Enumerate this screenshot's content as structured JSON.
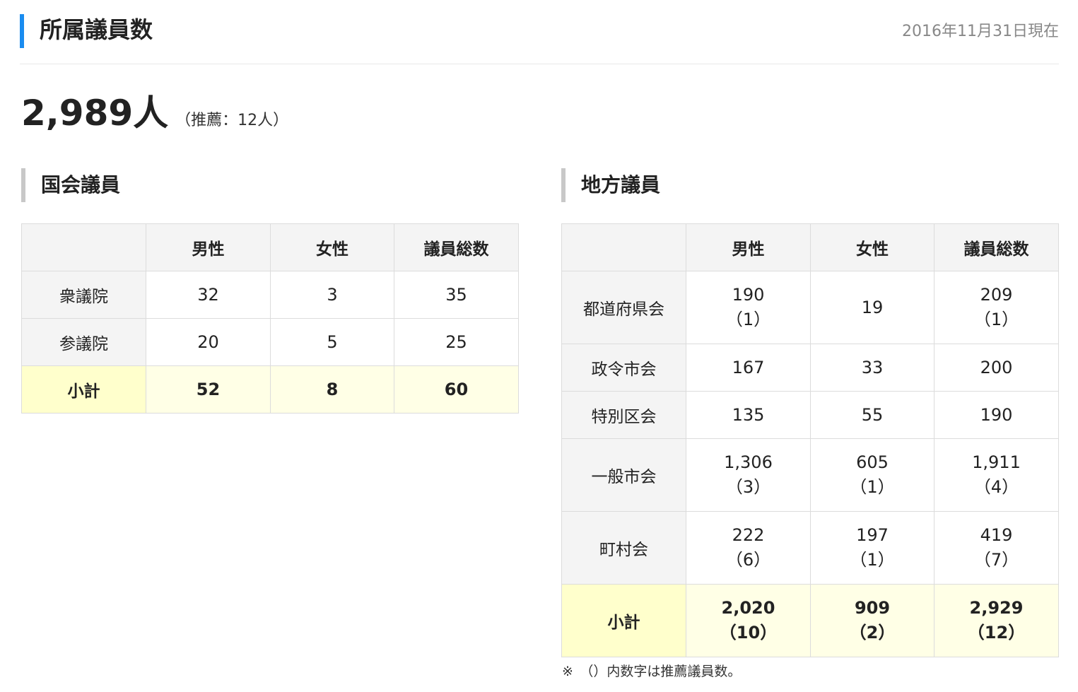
{
  "header": {
    "title": "所属議員数",
    "as_of": "2016年11月31日現在"
  },
  "summary": {
    "total": "2,989人",
    "note": "（推薦：12人）"
  },
  "national": {
    "heading": "国会議員",
    "columns": [
      "",
      "男性",
      "女性",
      "議員総数"
    ],
    "rows": [
      {
        "label": "衆議院",
        "male": "32",
        "female": "3",
        "total": "35"
      },
      {
        "label": "参議院",
        "male": "20",
        "female": "5",
        "total": "25"
      },
      {
        "label": "小計",
        "male": "52",
        "female": "8",
        "total": "60"
      }
    ]
  },
  "local": {
    "heading": "地方議員",
    "columns": [
      "",
      "男性",
      "女性",
      "議員総数"
    ],
    "rows": [
      {
        "label": "都道府県会",
        "male": "190",
        "male_rec": "（1）",
        "female": "19",
        "female_rec": "",
        "total": "209",
        "total_rec": "（1）"
      },
      {
        "label": "政令市会",
        "male": "167",
        "male_rec": "",
        "female": "33",
        "female_rec": "",
        "total": "200",
        "total_rec": ""
      },
      {
        "label": "特別区会",
        "male": "135",
        "male_rec": "",
        "female": "55",
        "female_rec": "",
        "total": "190",
        "total_rec": ""
      },
      {
        "label": "一般市会",
        "male": "1,306",
        "male_rec": "（3）",
        "female": "605",
        "female_rec": "（1）",
        "total": "1,911",
        "total_rec": "（4）"
      },
      {
        "label": "町村会",
        "male": "222",
        "male_rec": "（6）",
        "female": "197",
        "female_rec": "（1）",
        "total": "419",
        "total_rec": "（7）"
      },
      {
        "label": "小計",
        "male": "2,020",
        "male_rec": "（10）",
        "female": "909",
        "female_rec": "（2）",
        "total": "2,929",
        "total_rec": "（12）"
      }
    ]
  },
  "footnote": "※　（）内数字は推薦議員数。"
}
